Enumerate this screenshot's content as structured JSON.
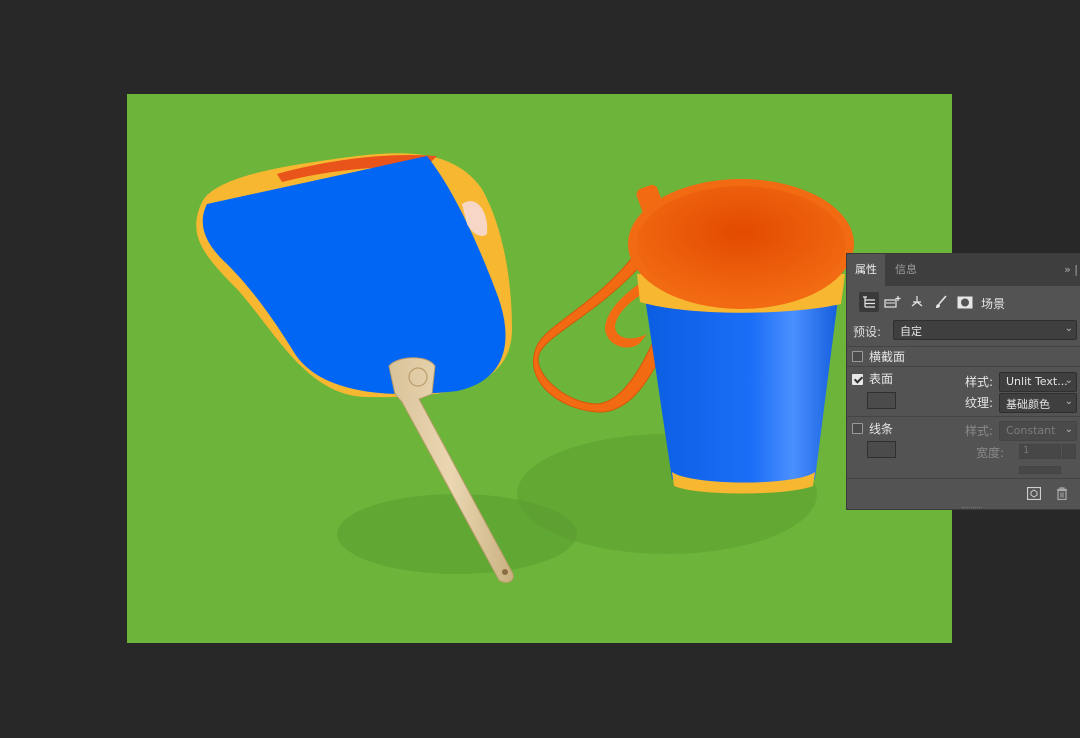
{
  "panel": {
    "tabs": [
      {
        "label": "属性",
        "active": true
      },
      {
        "label": "信息",
        "active": false
      }
    ],
    "collapse_icon": "double-chevron-right-icon",
    "toolbar": {
      "icons": [
        "scene-list-icon",
        "mesh-add-icon",
        "coordinates-icon",
        "brush-icon",
        "mask-icon"
      ],
      "scene_label": "场景"
    },
    "preset": {
      "label": "预设:",
      "value": "自定"
    },
    "cross_section": {
      "label": "横截面",
      "checked": false
    },
    "surface": {
      "label": "表面",
      "checked": true,
      "style_label": "样式:",
      "style_value": "Unlit Text...",
      "texture_label": "纹理:",
      "texture_value": "基础颜色"
    },
    "lines": {
      "label": "线条",
      "checked": false,
      "style_label": "样式:",
      "style_value": "Constant",
      "width_label": "宽度:",
      "width_value": "1"
    },
    "footer_icons": [
      "render-icon",
      "trash-icon"
    ]
  },
  "colors": {
    "workspace": "#282828",
    "canvas": "#6cb53a",
    "panel": "#535353",
    "fan_blue": "#0266f5",
    "cup_orange": "#f05a05",
    "accent_yellow": "#f7b731"
  }
}
